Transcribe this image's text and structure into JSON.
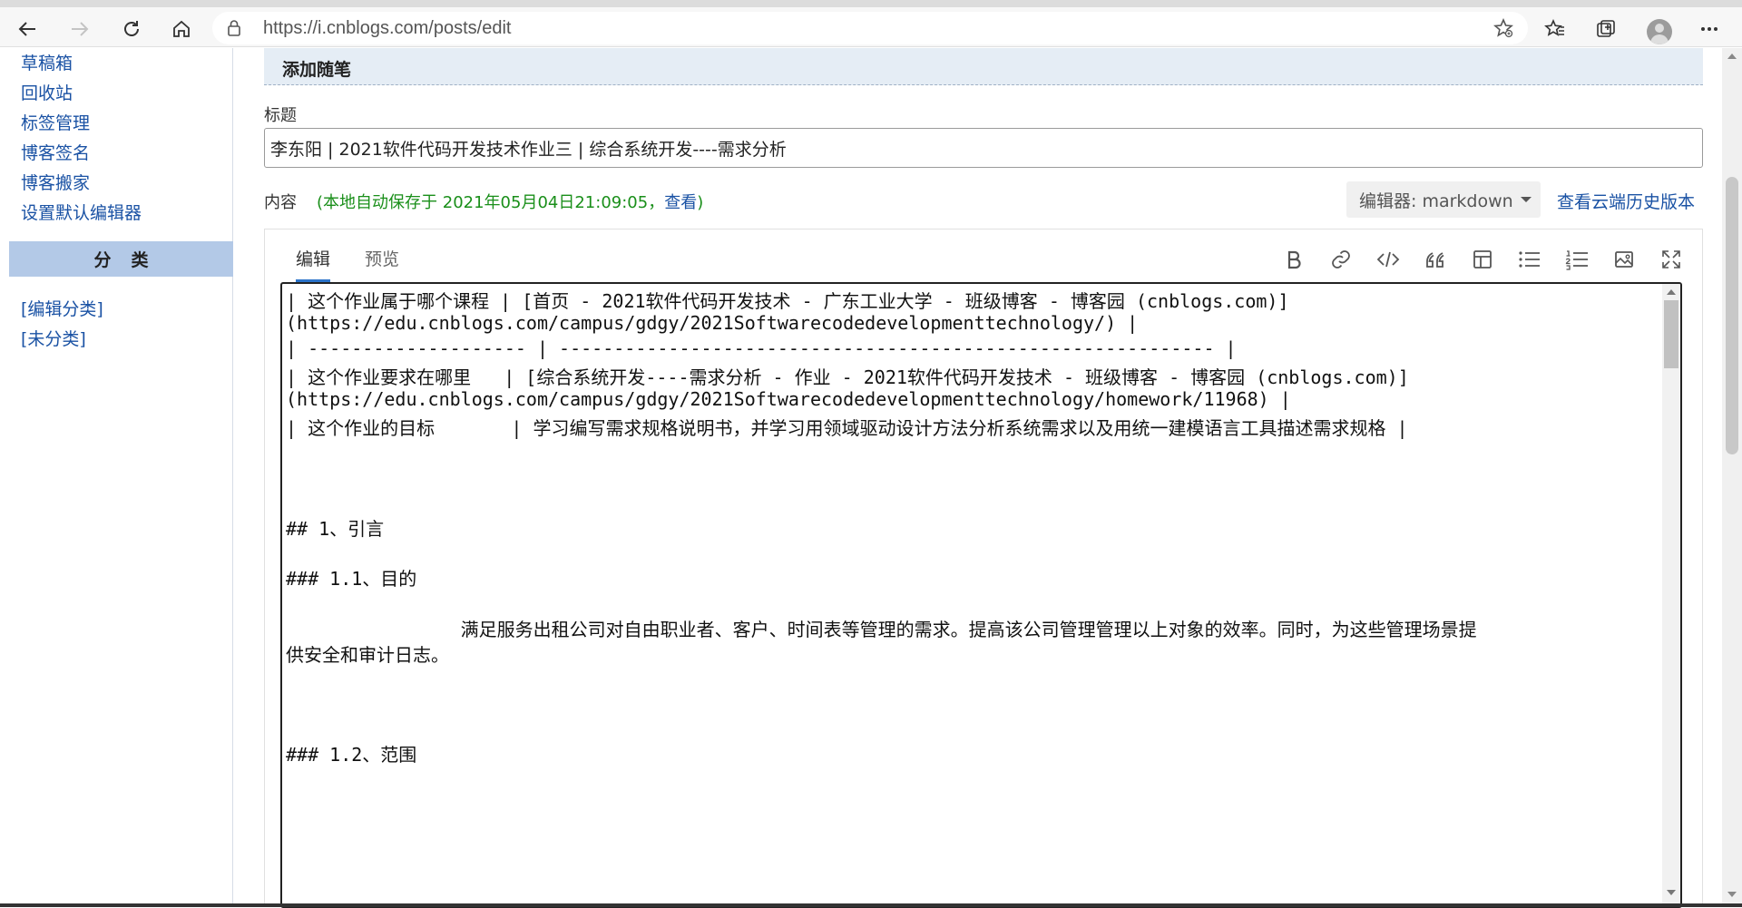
{
  "browser": {
    "url": "https://i.cnblogs.com/posts/edit"
  },
  "sidebar": {
    "links": [
      "草稿箱",
      "回收站",
      "标签管理",
      "博客签名",
      "博客搬家",
      "设置默认编辑器"
    ],
    "category_header": "分类",
    "category_links": [
      "[编辑分类]",
      "[未分类]"
    ]
  },
  "form": {
    "section_title": "添加随笔",
    "title_label": "标题",
    "title_value": "李东阳 | 2021软件代码开发技术作业三 | 综合系统开发----需求分析",
    "content_label": "内容",
    "autosave_text": "(本地自动保存于 2021年05月04日21:09:05，",
    "autosave_view": "查看",
    "autosave_close": ")",
    "editor_select": "编辑器: markdown",
    "history_link": "查看云端历史版本"
  },
  "editor": {
    "tabs": [
      "编辑",
      "预览"
    ],
    "toolbar_icons": [
      "bold-icon",
      "link-icon",
      "code-icon",
      "quote-icon",
      "table-icon",
      "bullet-list-icon",
      "numbered-list-icon",
      "image-icon",
      "fullscreen-icon"
    ],
    "lines": [
      "| 这个作业属于哪个课程 | [首页 - 2021软件代码开发技术 - 广东工业大学 - 班级博客 - 博客园 (cnblogs.com)]",
      "(https://edu.cnblogs.com/campus/gdgy/2021Softwarecodedevelopmenttechnology/) |",
      "| -------------------- | ------------------------------------------------------------ |",
      "| 这个作业要求在哪里   | [综合系统开发----需求分析 - 作业 - 2021软件代码开发技术 - 班级博客 - 博客园 (cnblogs.com)]",
      "(https://edu.cnblogs.com/campus/gdgy/2021Softwarecodedevelopmenttechnology/homework/11968) |",
      "| 这个作业的目标       | 学习编写需求规格说明书，并学习用领域驱动设计方法分析系统需求以及用统一建模语言工具描述需求规格 |",
      "## 1、引言",
      "### 1.1、目的",
      "                满足服务出租公司对自由职业者、客户、时间表等管理的需求。提高该公司管理管理以上对象的效率。同时，为这些管理场景提",
      "供安全和审计日志。",
      "### 1.2、范围"
    ]
  }
}
